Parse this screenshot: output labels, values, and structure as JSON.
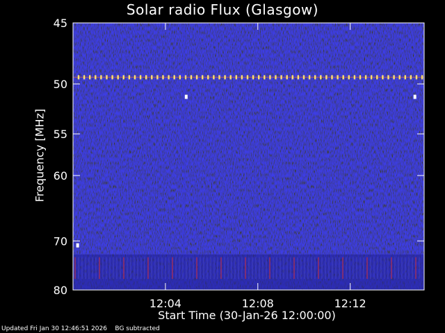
{
  "title": "Solar radio Flux (Glasgow)",
  "footer": "Updated Fri Jan 30 12:46:51 2026    BG subtracted",
  "chart_data": {
    "type": "heatmap",
    "title": "Solar radio Flux (Glasgow)",
    "xlabel": "Start Time (30-Jan-26 12:00:00)",
    "ylabel": "Frequency [MHz]",
    "x_range_minutes": [
      0.0,
      15.2
    ],
    "y_range_mhz": [
      45,
      80
    ],
    "x_ticks": [
      {
        "minute": 4,
        "label": "12:04"
      },
      {
        "minute": 8,
        "label": "12:08"
      },
      {
        "minute": 12,
        "label": "12:12"
      }
    ],
    "y_ticks": [
      {
        "value": 45,
        "label": "45"
      },
      {
        "value": 50,
        "label": "50"
      },
      {
        "value": 55,
        "label": "55"
      },
      {
        "value": 60,
        "label": "60"
      },
      {
        "value": 70,
        "label": "70"
      },
      {
        "value": 80,
        "label": "80"
      }
    ],
    "background": "uniform low-intensity noise",
    "features": [
      {
        "type": "interference line",
        "frequency_mhz": 49.4,
        "intensity": "high"
      },
      {
        "type": "faint broadband stripe",
        "minute": 4.8,
        "intensity": "low"
      },
      {
        "type": "RFI band",
        "frequency_mhz": [
          72.5,
          80.0
        ],
        "intensity": "medium"
      },
      {
        "type": "spot",
        "minute": 4.9,
        "frequency_mhz": 51.2,
        "intensity": "high"
      },
      {
        "type": "spot",
        "minute": 14.8,
        "frequency_mhz": 51.2,
        "intensity": "high"
      },
      {
        "type": "spot",
        "minute": 0.2,
        "frequency_mhz": 70.8,
        "intensity": "high"
      }
    ],
    "colors": {
      "background": "#000000",
      "low": "#1a1aa8",
      "medium": "#c0304a",
      "high": "#ffe070",
      "text": "#ffffff"
    }
  }
}
